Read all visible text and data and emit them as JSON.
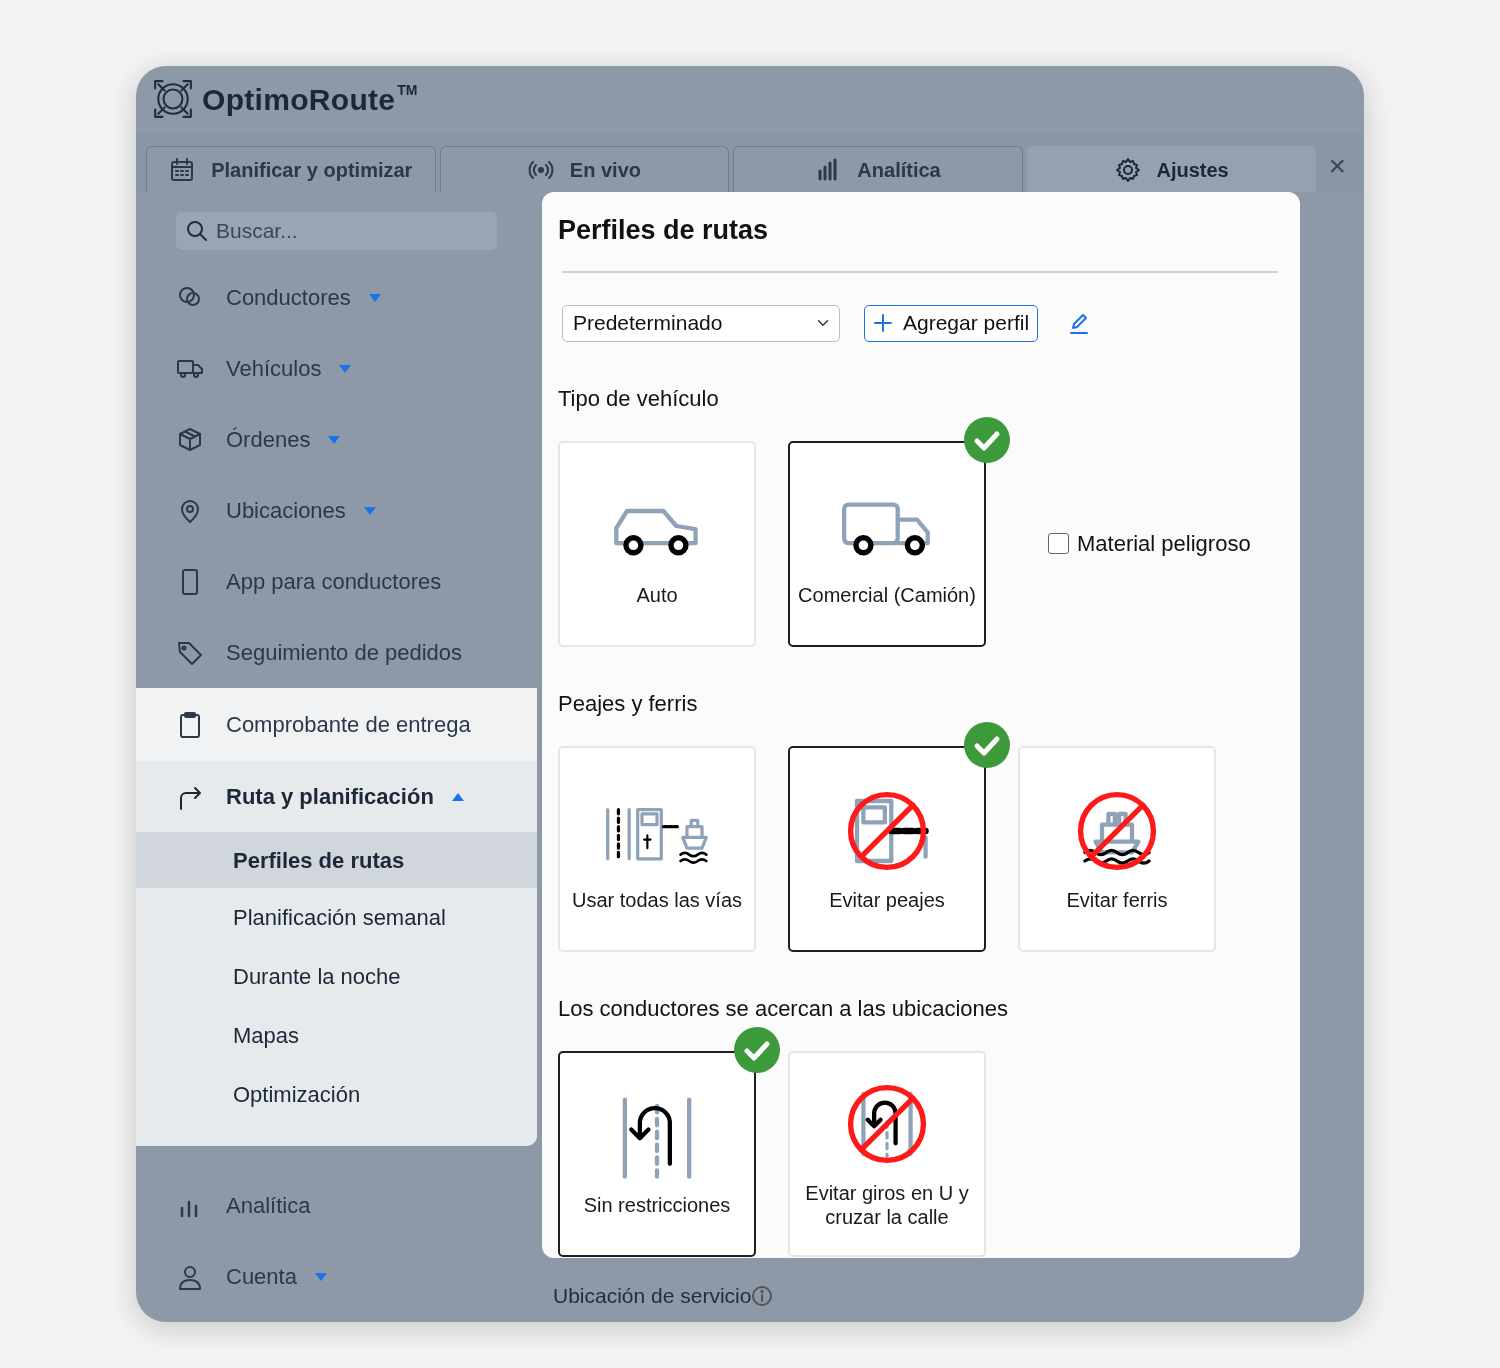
{
  "app": {
    "logo": "OptimoRoute",
    "trademark": "TM"
  },
  "tabs": [
    {
      "label": "Planificar y optimizar",
      "selected": false
    },
    {
      "label": "En vivo",
      "selected": false
    },
    {
      "label": "Analítica",
      "selected": false
    },
    {
      "label": "Ajustes",
      "selected": true
    }
  ],
  "close_label": "×",
  "sidebar": {
    "search": {
      "placeholder": "Buscar..."
    },
    "items": [
      {
        "label": "Conductores",
        "highlighted": false,
        "expanded": false
      },
      {
        "label": "Vehículos",
        "highlighted": false,
        "expanded": false
      },
      {
        "label": "Órdenes",
        "highlighted": false,
        "expanded": false
      },
      {
        "label": "Ubicaciones",
        "highlighted": false,
        "expanded": false
      },
      {
        "label": "App para conductores",
        "highlighted": false
      },
      {
        "label": "Seguimiento de pedidos",
        "highlighted": false
      },
      {
        "label": "Comprobante de entrega",
        "highlighted": true
      },
      {
        "label": "Ruta y planificación",
        "highlighted": false,
        "expanded": true,
        "children": [
          {
            "label": "Perfiles de rutas",
            "selected": true
          },
          {
            "label": "Planificación semanal",
            "selected": false
          },
          {
            "label": "Durante la noche",
            "selected": false
          },
          {
            "label": "Mapas",
            "selected": false
          },
          {
            "label": "Optimización",
            "selected": false
          }
        ]
      },
      {
        "label": "Analítica",
        "highlighted": false
      },
      {
        "label": "Cuenta",
        "highlighted": false,
        "expanded": false
      }
    ]
  },
  "panel": {
    "title": "Perfiles de rutas",
    "profile_select": {
      "value": "Predeterminado"
    },
    "add_button": "Agregar perfil",
    "sections": [
      {
        "title": "Tipo de vehículo",
        "options": [
          {
            "label": "Auto",
            "selected": false
          },
          {
            "label": "Comercial (Camión)",
            "selected": true
          }
        ],
        "checkbox": {
          "label": "Material peligroso",
          "checked": false
        }
      },
      {
        "title": "Peajes y ferris",
        "options": [
          {
            "label": "Usar todas las vías",
            "selected": false
          },
          {
            "label": "Evitar peajes",
            "selected": true
          },
          {
            "label": "Evitar ferris",
            "selected": false
          }
        ]
      },
      {
        "title": "Los conductores se acercan a las ubicaciones",
        "options": [
          {
            "label": "Sin restricciones",
            "selected": true
          },
          {
            "label": "Evitar giros en U y cruzar la calle",
            "selected": false
          }
        ]
      }
    ]
  },
  "footer_heading": "Ubicación de servicio"
}
